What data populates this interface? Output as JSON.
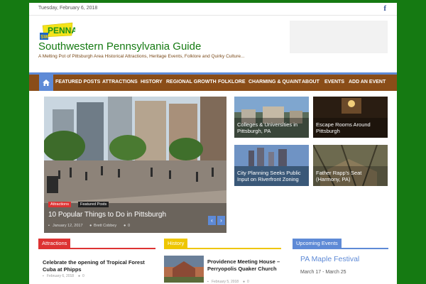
{
  "topbar": {
    "date": "Tuesday, February 6, 2018",
    "social_icon": "facebook-icon"
  },
  "header": {
    "logo_text": "PENNA",
    "logo_badge": "SW",
    "site_title": "Southwestern Pennsylvania Guide",
    "tagline": "A Melting Pot of Pittsburgh Area Historical Attractions, Heritage Events, Folklore and Quirky Culture..."
  },
  "nav": {
    "home_icon": "home-icon",
    "items": [
      "FEATURED POSTS",
      "ATTRACTIONS",
      "HISTORY",
      "REGIONAL GROWTH",
      "FOLKLORE",
      "CHARMING & QUAINT",
      "ABOUT",
      "EVENTS",
      "ADD AN EVENT"
    ]
  },
  "hero": {
    "tags": [
      "Attractions",
      "Featured Posts"
    ],
    "title": "10 Popular Things to Do in Pittsburgh",
    "date": "January 12, 2017",
    "author": "Brett Cobbey",
    "comments": "0",
    "prev_icon": "chevron-left-icon",
    "next_icon": "chevron-right-icon"
  },
  "featured_thumbs": [
    {
      "title": "Colleges & Universities in Pittsburgh, PA"
    },
    {
      "title": "Escape Rooms Around Pittsburgh"
    },
    {
      "title": "City Planning Seeks Public Input on Riverfront Zoning"
    },
    {
      "title": "Father Rapp's Seat (Harmony, PA)"
    }
  ],
  "sections": {
    "attractions": {
      "label": "Attractions",
      "post_title": "Celebrate the opening of Tropical Forest Cuba at Phipps",
      "post_date": "February 6, 2018",
      "post_comments": "0"
    },
    "history": {
      "label": "History",
      "post_title": "Providence Meeting House – Perryopolis Quaker Church",
      "post_date": "February 5, 2018",
      "post_comments": "0"
    },
    "events": {
      "label": "Upcoming Events",
      "event_title": "PA Maple Festival",
      "event_dates": "March 17 - March 25"
    }
  },
  "colors": {
    "brand_green": "#157a12",
    "nav_brown": "#8a4d18",
    "accent_blue": "#5e8ad6",
    "attractions_red": "#dd3333",
    "history_yellow": "#eec600"
  }
}
